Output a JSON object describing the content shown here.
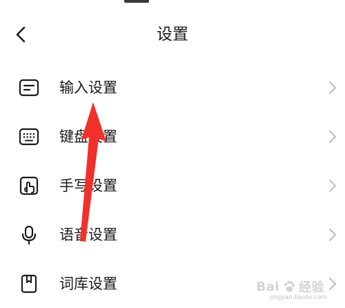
{
  "header": {
    "title": "设置",
    "back_icon": "chevron-left-icon"
  },
  "settings_items": [
    {
      "label": "输入设置",
      "icon": "input-box-icon"
    },
    {
      "label": "键盘设置",
      "icon": "keyboard-icon"
    },
    {
      "label": "手写设置",
      "icon": "handwriting-icon"
    },
    {
      "label": "语音设置",
      "icon": "microphone-icon"
    },
    {
      "label": "词库设置",
      "icon": "dictionary-icon"
    }
  ],
  "annotation": {
    "color": "#f2302a"
  },
  "watermark": {
    "brand": "Bai",
    "brand_suffix": "经验",
    "url": "jingyan.baidu.com"
  }
}
